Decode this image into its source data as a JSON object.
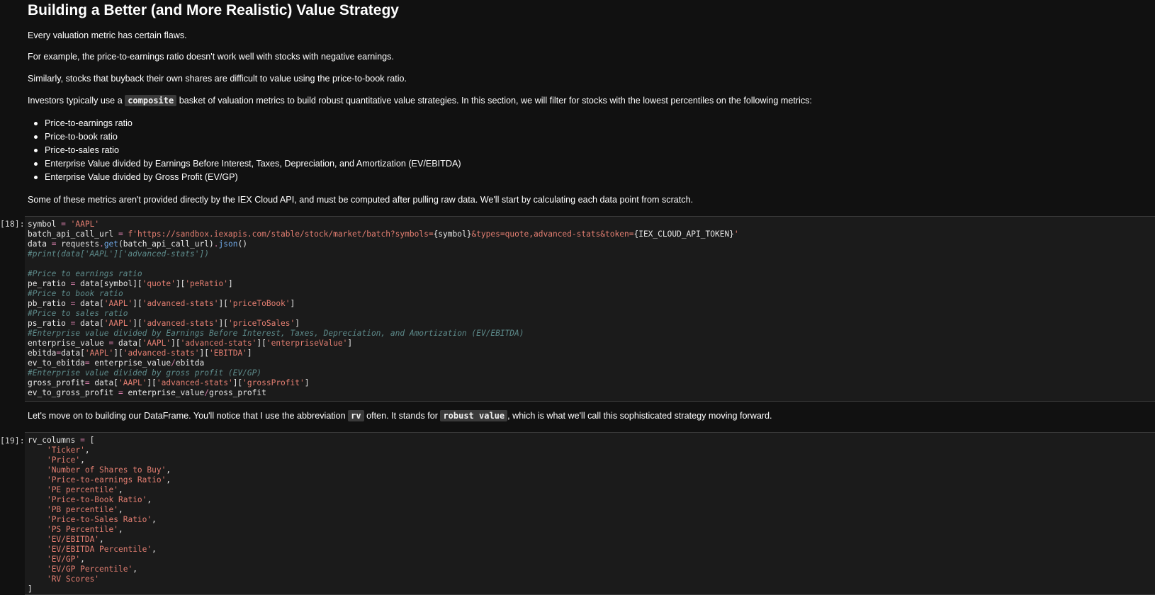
{
  "markdown1": {
    "title": "Building a Better (and More Realistic) Value Strategy",
    "p1": "Every valuation metric has certain flaws.",
    "p2": "For example, the price-to-earnings ratio doesn't work well with stocks with negative earnings.",
    "p3": "Similarly, stocks that buyback their own shares are difficult to value using the price-to-book ratio.",
    "p4_before": "Investors typically use a ",
    "p4_code": "composite",
    "p4_after": " basket of valuation metrics to build robust quantitative value strategies. In this section, we will filter for stocks with the lowest percentiles on the following metrics:",
    "list": [
      "Price-to-earnings ratio",
      "Price-to-book ratio",
      "Price-to-sales ratio",
      "Enterprise Value divided by Earnings Before Interest, Taxes, Depreciation, and Amortization (EV/EBITDA)",
      "Enterprise Value divided by Gross Profit (EV/GP)"
    ],
    "p5": "Some of these metrics aren't provided directly by the IEX Cloud API, and must be computed after pulling raw data. We'll start by calculating each data point from scratch."
  },
  "cell18": {
    "prompt": "[18]:",
    "lines": [
      [
        [
          "t",
          "symbol "
        ],
        [
          "o",
          "="
        ],
        [
          "t",
          " "
        ],
        [
          "s",
          "'AAPL'"
        ]
      ],
      [
        [
          "t",
          "batch_api_call_url "
        ],
        [
          "o",
          "="
        ],
        [
          "t",
          " "
        ],
        [
          "s",
          "f'https://sandbox.iexapis.com/stable/stock/market/batch?symbols="
        ],
        [
          "t",
          "{symbol}"
        ],
        [
          "s",
          "&types=quote,advanced-stats&token="
        ],
        [
          "t",
          "{IEX_CLOUD_API_TOKEN}"
        ],
        [
          "s",
          "'"
        ]
      ],
      [
        [
          "t",
          "data "
        ],
        [
          "o",
          "="
        ],
        [
          "t",
          " requests"
        ],
        [
          "o",
          "."
        ],
        [
          "b",
          "get"
        ],
        [
          "t",
          "(batch_api_call_url)"
        ],
        [
          "o",
          "."
        ],
        [
          "b",
          "json"
        ],
        [
          "t",
          "()"
        ]
      ],
      [
        [
          "c",
          "#print(data['AAPL']['advanced-stats'])"
        ]
      ],
      [
        [
          "t",
          ""
        ]
      ],
      [
        [
          "c",
          "#Price to earnings ratio"
        ]
      ],
      [
        [
          "t",
          "pe_ratio "
        ],
        [
          "o",
          "="
        ],
        [
          "t",
          " data[symbol]["
        ],
        [
          "s",
          "'quote'"
        ],
        [
          "t",
          "]["
        ],
        [
          "s",
          "'peRatio'"
        ],
        [
          "t",
          "]"
        ]
      ],
      [
        [
          "c",
          "#Price to book ratio"
        ]
      ],
      [
        [
          "t",
          "pb_ratio "
        ],
        [
          "o",
          "="
        ],
        [
          "t",
          " data["
        ],
        [
          "s",
          "'AAPL'"
        ],
        [
          "t",
          "]["
        ],
        [
          "s",
          "'advanced-stats'"
        ],
        [
          "t",
          "]["
        ],
        [
          "s",
          "'priceToBook'"
        ],
        [
          "t",
          "]"
        ]
      ],
      [
        [
          "c",
          "#Price to sales ratio"
        ]
      ],
      [
        [
          "t",
          "ps_ratio "
        ],
        [
          "o",
          "="
        ],
        [
          "t",
          " data["
        ],
        [
          "s",
          "'AAPL'"
        ],
        [
          "t",
          "]["
        ],
        [
          "s",
          "'advanced-stats'"
        ],
        [
          "t",
          "]["
        ],
        [
          "s",
          "'priceToSales'"
        ],
        [
          "t",
          "]"
        ]
      ],
      [
        [
          "c",
          "#Enterprise value divided by Earnings Before Interest, Taxes, Depreciation, and Amortization (EV/EBITDA)"
        ]
      ],
      [
        [
          "t",
          "enterprise_value "
        ],
        [
          "o",
          "="
        ],
        [
          "t",
          " data["
        ],
        [
          "s",
          "'AAPL'"
        ],
        [
          "t",
          "]["
        ],
        [
          "s",
          "'advanced-stats'"
        ],
        [
          "t",
          "]["
        ],
        [
          "s",
          "'enterpriseValue'"
        ],
        [
          "t",
          "]"
        ]
      ],
      [
        [
          "t",
          "ebitda"
        ],
        [
          "o",
          "="
        ],
        [
          "t",
          "data["
        ],
        [
          "s",
          "'AAPL'"
        ],
        [
          "t",
          "]["
        ],
        [
          "s",
          "'advanced-stats'"
        ],
        [
          "t",
          "]["
        ],
        [
          "s",
          "'EBITDA'"
        ],
        [
          "t",
          "]"
        ]
      ],
      [
        [
          "t",
          "ev_to_ebitda"
        ],
        [
          "o",
          "="
        ],
        [
          "t",
          " enterprise_value"
        ],
        [
          "o",
          "/"
        ],
        [
          "t",
          "ebitda"
        ]
      ],
      [
        [
          "c",
          "#Enterprise value divided by gross profit (EV/GP)"
        ]
      ],
      [
        [
          "t",
          "gross_profit"
        ],
        [
          "o",
          "="
        ],
        [
          "t",
          " data["
        ],
        [
          "s",
          "'AAPL'"
        ],
        [
          "t",
          "]["
        ],
        [
          "s",
          "'advanced-stats'"
        ],
        [
          "t",
          "]["
        ],
        [
          "s",
          "'grossProfit'"
        ],
        [
          "t",
          "]"
        ]
      ],
      [
        [
          "t",
          "ev_to_gross_profit "
        ],
        [
          "o",
          "="
        ],
        [
          "t",
          " enterprise_value"
        ],
        [
          "o",
          "/"
        ],
        [
          "t",
          "gross_profit"
        ]
      ]
    ]
  },
  "markdown2": {
    "before": "Let's move on to building our DataFrame. You'll notice that I use the abbreviation ",
    "code1": "rv",
    "middle": " often. It stands for ",
    "code2": "robust value",
    "after": ", which is what we'll call this sophisticated strategy moving forward."
  },
  "cell19": {
    "prompt": "[19]:",
    "lines": [
      [
        [
          "t",
          "rv_columns "
        ],
        [
          "o",
          "="
        ],
        [
          "t",
          " ["
        ]
      ],
      [
        [
          "t",
          "    "
        ],
        [
          "s",
          "'Ticker'"
        ],
        [
          "t",
          ","
        ]
      ],
      [
        [
          "t",
          "    "
        ],
        [
          "s",
          "'Price'"
        ],
        [
          "t",
          ","
        ]
      ],
      [
        [
          "t",
          "    "
        ],
        [
          "s",
          "'Number of Shares to Buy'"
        ],
        [
          "t",
          ","
        ]
      ],
      [
        [
          "t",
          "    "
        ],
        [
          "s",
          "'Price-to-earnings Ratio'"
        ],
        [
          "t",
          ","
        ]
      ],
      [
        [
          "t",
          "    "
        ],
        [
          "s",
          "'PE percentile'"
        ],
        [
          "t",
          ","
        ]
      ],
      [
        [
          "t",
          "    "
        ],
        [
          "s",
          "'Price-to-Book Ratio'"
        ],
        [
          "t",
          ","
        ]
      ],
      [
        [
          "t",
          "    "
        ],
        [
          "s",
          "'PB percentile'"
        ],
        [
          "t",
          ","
        ]
      ],
      [
        [
          "t",
          "    "
        ],
        [
          "s",
          "'Price-to-Sales Ratio'"
        ],
        [
          "t",
          ","
        ]
      ],
      [
        [
          "t",
          "    "
        ],
        [
          "s",
          "'PS Percentile'"
        ],
        [
          "t",
          ","
        ]
      ],
      [
        [
          "t",
          "    "
        ],
        [
          "s",
          "'EV/EBITDA'"
        ],
        [
          "t",
          ","
        ]
      ],
      [
        [
          "t",
          "    "
        ],
        [
          "s",
          "'EV/EBITDA Percentile'"
        ],
        [
          "t",
          ","
        ]
      ],
      [
        [
          "t",
          "    "
        ],
        [
          "s",
          "'EV/GP'"
        ],
        [
          "t",
          ","
        ]
      ],
      [
        [
          "t",
          "    "
        ],
        [
          "s",
          "'EV/GP Percentile'"
        ],
        [
          "t",
          ","
        ]
      ],
      [
        [
          "t",
          "    "
        ],
        [
          "s",
          "'RV Scores'"
        ]
      ],
      [
        [
          "t",
          "]"
        ]
      ]
    ]
  }
}
